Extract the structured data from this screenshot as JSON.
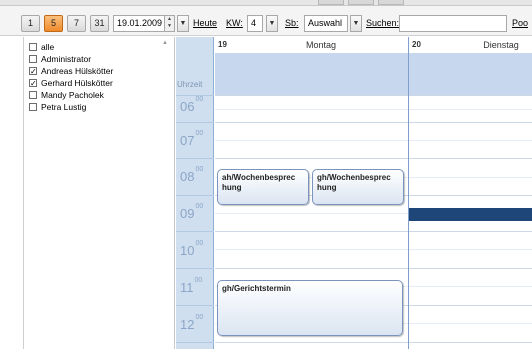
{
  "toolbar": {
    "view_buttons": [
      "1",
      "5",
      "7",
      "31"
    ],
    "active_view": "5",
    "date": "19.01.2009",
    "today_label": "Heute",
    "kw_label": "KW:",
    "kw_value": "4",
    "sb_label": "Sb:",
    "sb_value": "Auswahl",
    "search_label": "Suchen:",
    "search_value": "",
    "pool_label": "Poo"
  },
  "users": [
    {
      "name": "alle",
      "checked": false
    },
    {
      "name": "Administrator",
      "checked": false
    },
    {
      "name": "Andreas Hülskötter",
      "checked": true
    },
    {
      "name": "Gerhard Hülskötter",
      "checked": true
    },
    {
      "name": "Mandy Pacholek",
      "checked": false
    },
    {
      "name": "Petra Lustig",
      "checked": false
    }
  ],
  "calendar": {
    "time_header": "Uhrzeit",
    "hours": [
      {
        "h": "06",
        "m": "00"
      },
      {
        "h": "07",
        "m": "00"
      },
      {
        "h": "08",
        "m": "00"
      },
      {
        "h": "09",
        "m": "00"
      },
      {
        "h": "10",
        "m": "00"
      },
      {
        "h": "11",
        "m": "00"
      },
      {
        "h": "12",
        "m": "00"
      }
    ],
    "days": [
      {
        "num": "19",
        "name": "Montag"
      },
      {
        "num": "20",
        "name": "Dienstag"
      }
    ],
    "appointments": [
      {
        "title": "ah/Wochenbesprechung",
        "line1": "ah/Wochenbesprec",
        "line2": "hung"
      },
      {
        "title": "gh/Wochenbesprechung",
        "line1": "gh/Wochenbesprec",
        "line2": "hung"
      },
      {
        "title": "gh/Gerichtstermin",
        "line1": "gh/Gerichtstermin",
        "line2": ""
      }
    ]
  },
  "colors": {
    "accent_active": "#ef8a2a",
    "time_column": "#cfdff0",
    "allday": "#c7d8ee",
    "selection": "#1f4678"
  }
}
